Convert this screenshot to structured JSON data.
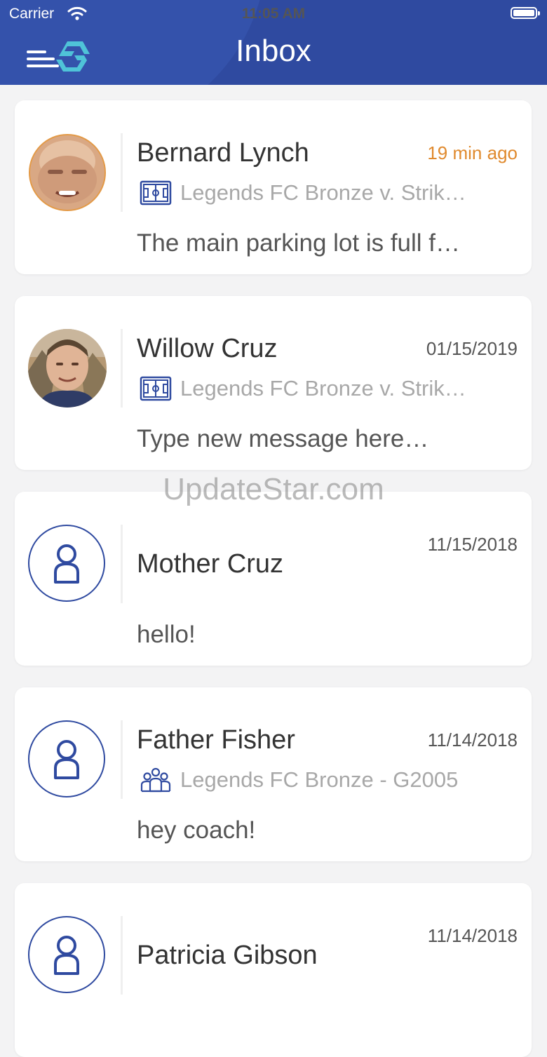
{
  "status_bar": {
    "carrier": "Carrier",
    "time": "11:05 AM"
  },
  "header": {
    "title": "Inbox"
  },
  "watermark": "UpdateStar.com",
  "conversations": [
    {
      "name": "Bernard Lynch",
      "time": "19 min ago",
      "context": "Legends FC Bronze v. Strik…",
      "context_icon": "soccer-field-icon",
      "message": "The main parking lot is full f…",
      "avatar": "photo"
    },
    {
      "name": "Willow Cruz",
      "time": "01/15/2019",
      "context": "Legends FC Bronze v. Strik…",
      "context_icon": "soccer-field-icon",
      "message": "Type new message here…",
      "avatar": "photo"
    },
    {
      "name": "Mother Cruz",
      "time": "11/15/2018",
      "context": "",
      "message": "hello!",
      "avatar": "person-icon"
    },
    {
      "name": "Father Fisher",
      "time": "11/14/2018",
      "context": "Legends FC Bronze - G2005",
      "context_icon": "team-icon",
      "message": "hey coach!",
      "avatar": "person-icon"
    },
    {
      "name": "Patricia Gibson",
      "time": "11/14/2018",
      "context": "",
      "message": "",
      "avatar": "person-icon"
    }
  ],
  "colors": {
    "header": "#2f4aa0",
    "accent_time": "#e08a2e",
    "logo": "#4fc3d8"
  }
}
